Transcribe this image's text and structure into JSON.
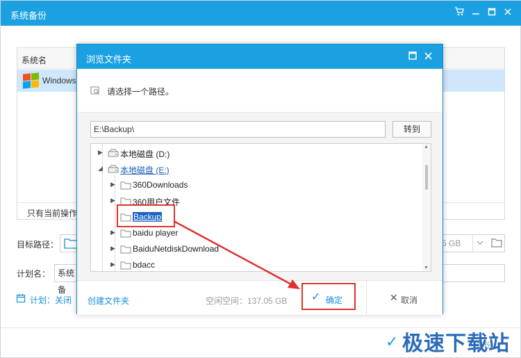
{
  "main_window": {
    "title": "系统备份",
    "list": {
      "header": "系统名",
      "row": "Windows",
      "footer_note": "只有当前操作系"
    },
    "target_path_label": "目标路径：",
    "target_path_partial": "5 GB",
    "plan_name_label": "计划名：",
    "plan_name_value": "系统备",
    "plan_link": "计划：关闭",
    "watermark": "极速下载站",
    "watermark_behind": "备份"
  },
  "dialog": {
    "title": "浏览文件夹",
    "tip": "请选择一个路径。",
    "path_value": "E:\\Backup\\",
    "go_button": "转到",
    "tree": [
      {
        "label": "本地磁盘 (D:)",
        "type": "drive",
        "level": 0,
        "expanded": false
      },
      {
        "label": "本地磁盘 (E:)",
        "type": "drive",
        "level": 0,
        "expanded": true,
        "style": "link"
      },
      {
        "label": "360Downloads",
        "type": "folder",
        "level": 1,
        "expanded": false
      },
      {
        "label": "360用户文件",
        "type": "folder",
        "level": 1,
        "expanded": false
      },
      {
        "label": "Backup",
        "type": "folder",
        "level": 1,
        "expanded": null,
        "selected": true
      },
      {
        "label": "baidu player",
        "type": "folder",
        "level": 1,
        "expanded": false
      },
      {
        "label": "BaiduNetdiskDownload",
        "type": "folder",
        "level": 1,
        "expanded": false
      },
      {
        "label": "bdacc",
        "type": "folder",
        "level": 1,
        "expanded": false
      }
    ],
    "create_folder": "创建文件夹",
    "free_space": "空闲空间：137.05 GB",
    "ok_button": "确定",
    "cancel_button": "取消"
  },
  "colors": {
    "title_bar": "#1ba1e2",
    "link": "#1a8fd8",
    "selection": "#1b63c4",
    "annotation": "#e0312f",
    "watermark": "#2b6bb8"
  }
}
